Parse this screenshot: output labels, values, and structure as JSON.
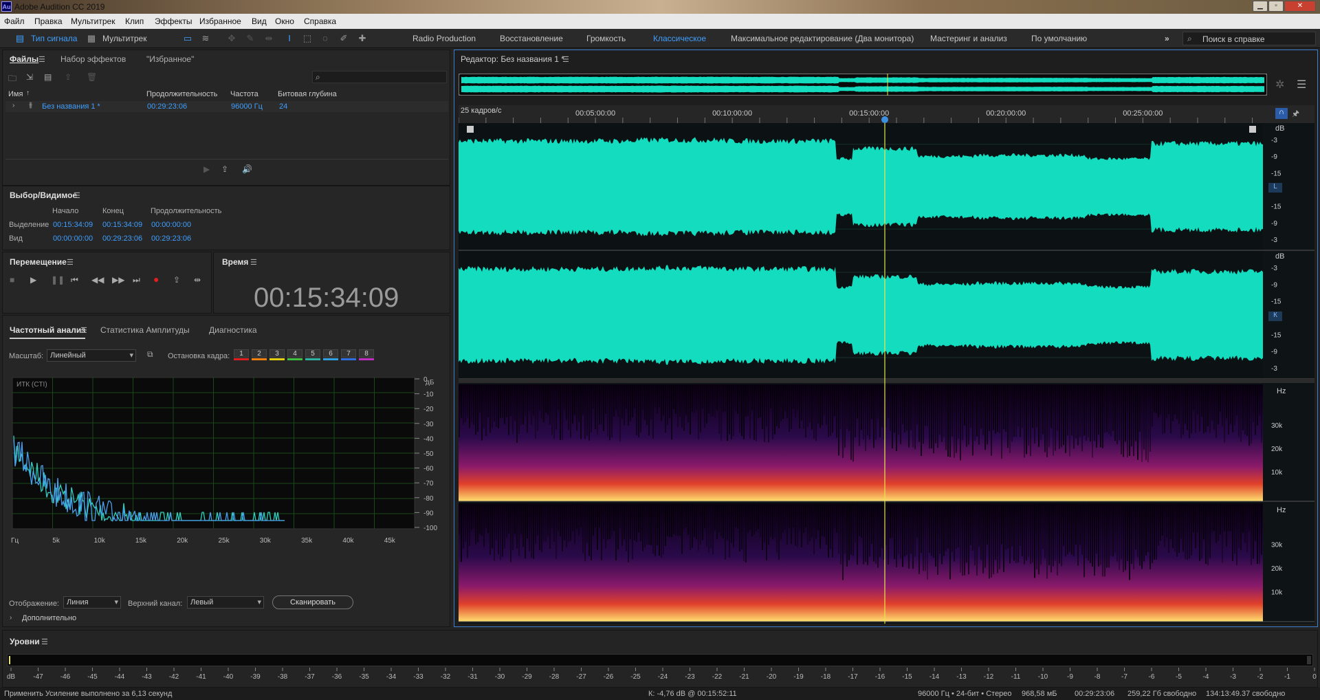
{
  "app": {
    "title": "Adobe Audition CC 2019",
    "logo": "Au"
  },
  "menu": [
    "Файл",
    "Правка",
    "Мультитрек",
    "Клип",
    "Эффекты",
    "Избранное",
    "Вид",
    "Окно",
    "Справка"
  ],
  "toolbar": {
    "waveform": "Тип сигнала",
    "multitrack": "Мультитрек",
    "workspaces": [
      "Radio Production",
      "Восстановление",
      "Громкость",
      "Классическое",
      "Максимальное редактирование (Два монитора)",
      "Мастеринг и анализ",
      "По умолчанию"
    ],
    "active_workspace": "Классическое",
    "search_placeholder": "Поиск в справке"
  },
  "files": {
    "tabs": [
      "Файлы",
      "Набор эффектов",
      "\"Избранное\""
    ],
    "columns": [
      "Имя",
      "Продолжительность",
      "Частота",
      "Битовая глубина"
    ],
    "rows": [
      {
        "name": "Без названия 1 *",
        "duration": "00:29:23:06",
        "rate": "96000 Гц",
        "depth": "24"
      }
    ]
  },
  "selection": {
    "title": "Выбор/Видимое",
    "headers": [
      "Начало",
      "Конец",
      "Продолжительность"
    ],
    "rows": [
      {
        "label": "Выделение",
        "start": "00:15:34:09",
        "end": "00:15:34:09",
        "dur": "00:00:00:00"
      },
      {
        "label": "Вид",
        "start": "00:00:00:00",
        "end": "00:29:23:06",
        "dur": "00:29:23:06"
      }
    ]
  },
  "transport": {
    "title": "Перемещение"
  },
  "time": {
    "title": "Время",
    "value": "00:15:34:09"
  },
  "freq": {
    "tabs": [
      "Частотный анализ",
      "Статистика Амплитуды",
      "Диагностика"
    ],
    "scale_label": "Масштаб:",
    "scale_value": "Линейный",
    "freeze_label": "Остановка кадра:",
    "freeze_buttons": [
      "1",
      "2",
      "3",
      "4",
      "5",
      "6",
      "7",
      "8"
    ],
    "freeze_colors": [
      "#e02020",
      "#f08010",
      "#e0d010",
      "#40c040",
      "#30b0a0",
      "#30a0e0",
      "#3070e0",
      "#c030c0"
    ],
    "plot_label": "ИТК (CTI)",
    "db_unit": "дБ",
    "db_ticks": [
      "0",
      "-10",
      "-20",
      "-30",
      "-40",
      "-50",
      "-60",
      "-70",
      "-80",
      "-90",
      "-100"
    ],
    "hz_ticks": [
      "Гц",
      "5k",
      "10k",
      "15k",
      "20k",
      "25k",
      "30k",
      "35k",
      "40k",
      "45k"
    ],
    "display_label": "Отображение:",
    "display_value": "Линия",
    "channel_label": "Верхний канал:",
    "channel_value": "Левый",
    "scan_button": "Сканировать",
    "more": "Дополнительно"
  },
  "editor": {
    "title": "Редактор: Без названия 1 *",
    "fps": "25 кадров/с",
    "ruler": [
      "00:05:00:00",
      "00:10:00:00",
      "00:15:00:00",
      "00:20:00:00",
      "00:25:00:00"
    ],
    "db_label": "dB",
    "db_ticks": [
      "-3",
      "-9",
      "-15",
      "-∞",
      "-15",
      "-9",
      "-3"
    ],
    "ch_left": "L",
    "ch_right": "К",
    "hz_label": "Hz",
    "hz_ticks": [
      "30k",
      "20k",
      "10k"
    ],
    "colors": {
      "wave": "#14dcbe",
      "playhead": "#e8e850"
    }
  },
  "levels": {
    "title": "Уровни",
    "ticks": [
      "dB",
      "-47",
      "-46",
      "-45",
      "-44",
      "-43",
      "-42",
      "-41",
      "-40",
      "-39",
      "-38",
      "-37",
      "-36",
      "-35",
      "-34",
      "-33",
      "-32",
      "-31",
      "-30",
      "-29",
      "-28",
      "-27",
      "-26",
      "-25",
      "-24",
      "-23",
      "-22",
      "-21",
      "-20",
      "-19",
      "-18",
      "-17",
      "-16",
      "-15",
      "-14",
      "-13",
      "-12",
      "-11",
      "-10",
      "-9",
      "-8",
      "-7",
      "-6",
      "-5",
      "-4",
      "-3",
      "-2",
      "-1",
      "0"
    ]
  },
  "status": {
    "message": "Применить Усиление выполнено за 6,13 секунд",
    "cursor": "К: -4,76 dB @ 00:15:52:11",
    "format": "96000 Гц • 24-бит • Стерео",
    "size": "968,58 мБ",
    "duration": "00:29:23:06",
    "free": "259,22 Гб свободно",
    "free_time": "134:13:49.37 свободно"
  }
}
